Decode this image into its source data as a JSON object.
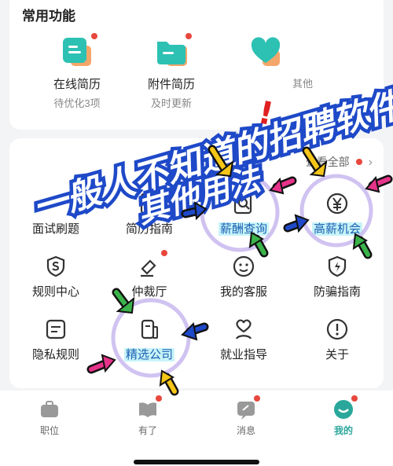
{
  "section": {
    "title": "常用功能"
  },
  "top_items": [
    {
      "label": "在线简历",
      "sub": "待优化3项"
    },
    {
      "label": "附件简历",
      "sub": "及时更新"
    },
    {
      "label": "",
      "sub": "其他"
    }
  ],
  "more": {
    "label": "查看全部"
  },
  "grid": [
    {
      "label": "面试刷题"
    },
    {
      "label": "简历指南"
    },
    {
      "label": "薪酬查询"
    },
    {
      "label": "高薪机会"
    },
    {
      "label": "规则中心"
    },
    {
      "label": "仲裁厅"
    },
    {
      "label": "我的客服"
    },
    {
      "label": "防骗指南"
    },
    {
      "label": "隐私规则"
    },
    {
      "label": "精选公司"
    },
    {
      "label": "就业指导"
    },
    {
      "label": "关于"
    }
  ],
  "nav": [
    {
      "label": "职位"
    },
    {
      "label": "有了"
    },
    {
      "label": "消息"
    },
    {
      "label": "我的"
    }
  ],
  "overlay": {
    "line1": "一般人不知道的招聘软件",
    "line2": "其他用法",
    "exclaim": "!"
  },
  "colors": {
    "accent": "#2aa79b",
    "dot": "#e8473d",
    "banner": "#1e49c8",
    "highlight": "#c8f4f8"
  }
}
